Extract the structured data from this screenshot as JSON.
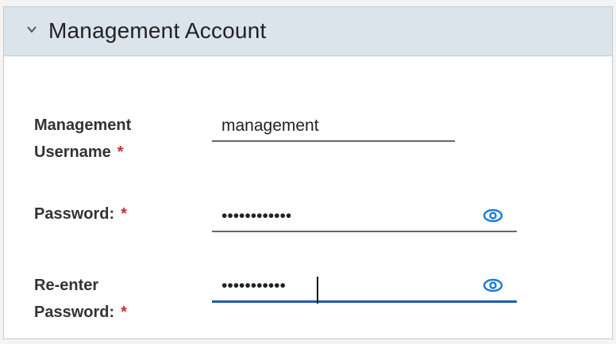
{
  "panel": {
    "title": "Management Account",
    "chevron_icon": "chevron-down-icon"
  },
  "form": {
    "username": {
      "label_line1": "Management",
      "label_line2": "Username",
      "required": "*",
      "value": "management"
    },
    "password": {
      "label": "Password:",
      "required": "*",
      "value": "••••••••••••",
      "icon": "eye-icon"
    },
    "reenter_password": {
      "label_line1": "Re-enter",
      "label_line2": "Password:",
      "required": "*",
      "value": "•••••••••••",
      "icon": "eye-icon"
    }
  },
  "colors": {
    "header_bg": "#dbe3eb",
    "required": "#c4302b",
    "accent": "#1d5ab6",
    "eye_icon": "#1d7fd6"
  }
}
